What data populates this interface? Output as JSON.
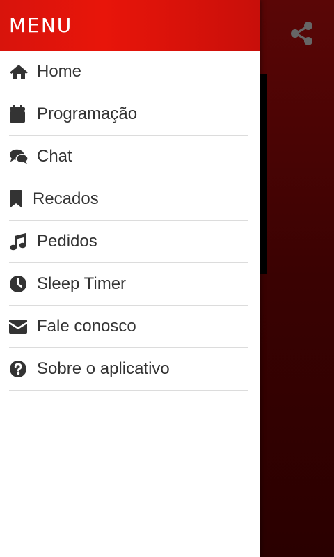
{
  "header": {
    "title": "MENU"
  },
  "actions": {
    "share_icon": "share-icon"
  },
  "menu": {
    "items": [
      {
        "label": "Home",
        "icon": "home-icon"
      },
      {
        "label": "Programação",
        "icon": "calendar-icon"
      },
      {
        "label": "Chat",
        "icon": "chat-icon"
      },
      {
        "label": "Recados",
        "icon": "bookmark-icon"
      },
      {
        "label": "Pedidos",
        "icon": "music-note-icon"
      },
      {
        "label": "Sleep Timer",
        "icon": "clock-icon"
      },
      {
        "label": "Fale conosco",
        "icon": "envelope-icon"
      },
      {
        "label": "Sobre o aplicativo",
        "icon": "question-circle-icon"
      }
    ]
  },
  "colors": {
    "header_red": "#e8150a",
    "background_dark_red": "#3a0202",
    "text": "#333333",
    "icon": "#333333",
    "divider": "#dcdcdc"
  }
}
